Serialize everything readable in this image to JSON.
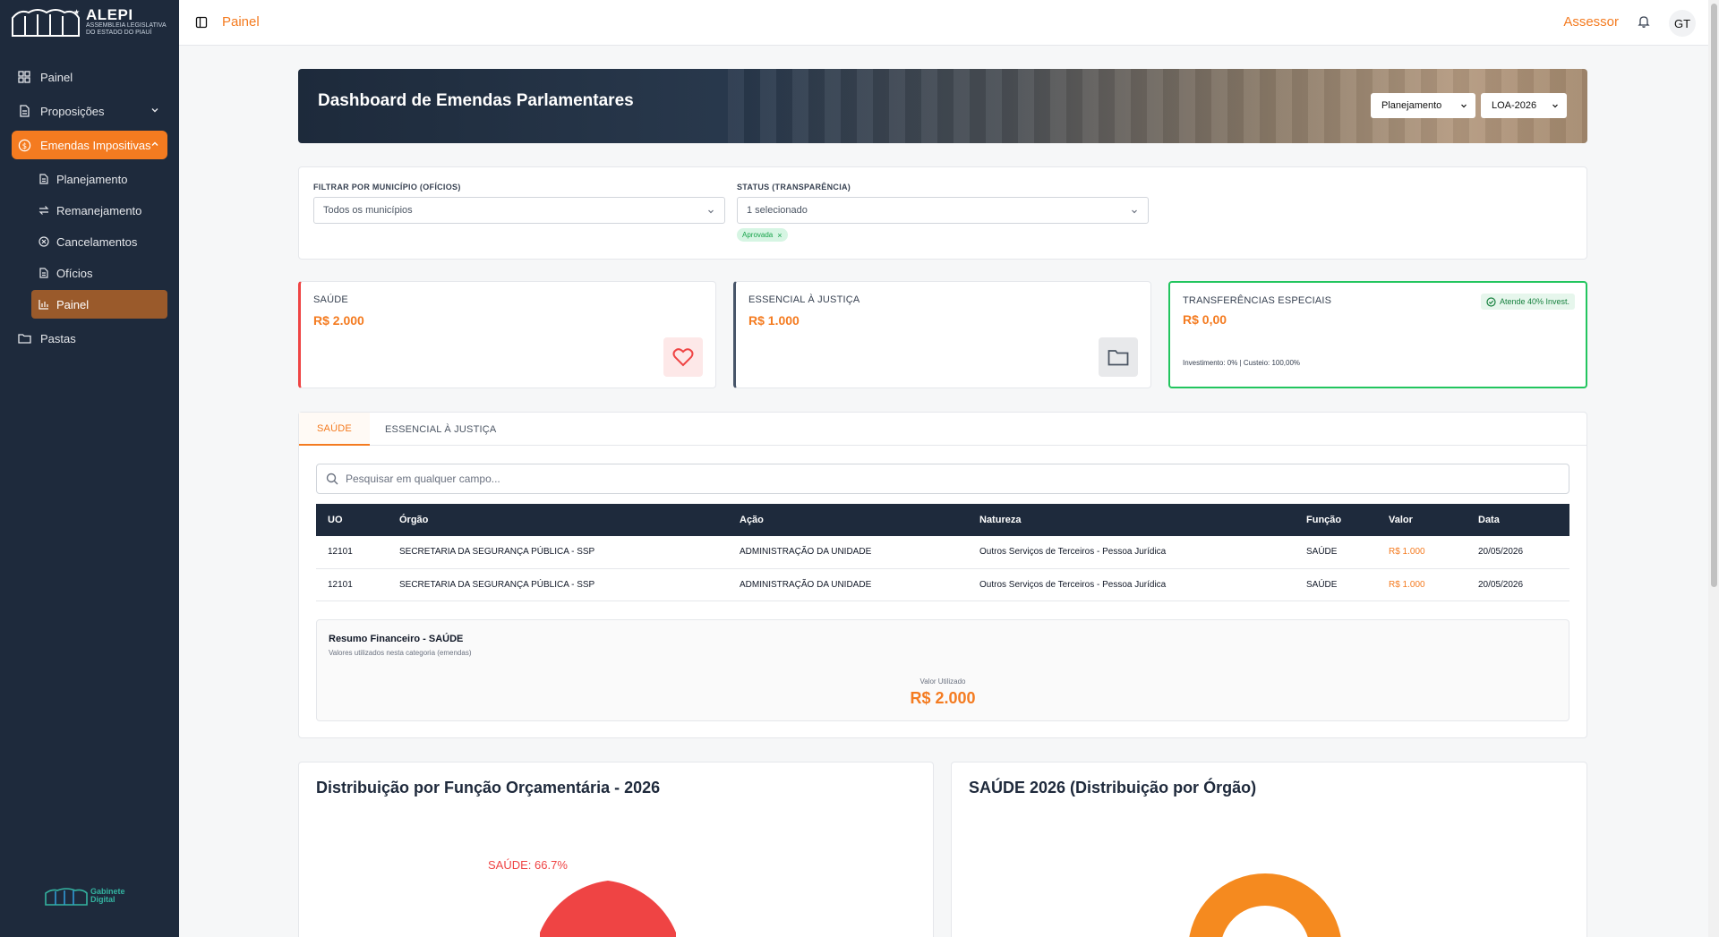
{
  "sidebar": {
    "logo": {
      "name": "ALEPI",
      "subtitle_line1": "ASSEMBLEIA LEGISLATIVA",
      "subtitle_line2": "DO ESTADO DO PIAUÍ"
    },
    "items": [
      {
        "label": "Painel",
        "icon": "grid-icon"
      },
      {
        "label": "Proposições",
        "icon": "document-icon"
      },
      {
        "label": "Emendas Impositivas",
        "icon": "dollar-circle-icon",
        "active": true
      },
      {
        "label": "Pastas",
        "icon": "folder-icon"
      }
    ],
    "subitems": [
      {
        "label": "Planejamento",
        "icon": "file-icon"
      },
      {
        "label": "Remanejamento",
        "icon": "swap-icon"
      },
      {
        "label": "Cancelamentos",
        "icon": "x-circle-icon"
      },
      {
        "label": "Ofícios",
        "icon": "file-icon"
      },
      {
        "label": "Painel",
        "icon": "bar-chart-icon",
        "active": true
      }
    ],
    "footer": {
      "line1": "Gabinete",
      "line2": "Digital"
    }
  },
  "header": {
    "breadcrumb": "Painel",
    "role": "Assessor",
    "avatar": "GT"
  },
  "hero": {
    "title": "Dashboard de Emendas Parlamentares",
    "select1": "Planejamento",
    "select2": "LOA-2026"
  },
  "filters": {
    "municipio_label": "FILTRAR POR MUNICÍPIO (OFÍCIOS)",
    "municipio_value": "Todos os municípios",
    "status_label": "STATUS (TRANSPARÊNCIA)",
    "status_value": "1 selecionado",
    "status_tag": "Aprovada"
  },
  "stats": [
    {
      "title": "SAÚDE",
      "value": "R$ 2.000",
      "accent": "#ef4444"
    },
    {
      "title": "ESSENCIAL À JUSTIÇA",
      "value": "R$ 1.000",
      "accent": "#475569"
    },
    {
      "title": "TRANSFERÊNCIAS ESPECIAIS",
      "value": "R$ 0,00",
      "accent": "#22c55e",
      "badge": "Atende 40% Invest.",
      "note": "Investimento: 0% | Custeio: 100,00%"
    }
  ],
  "tabs": [
    "SAÚDE",
    "ESSENCIAL À JUSTIÇA"
  ],
  "search": {
    "placeholder": "Pesquisar em qualquer campo..."
  },
  "table": {
    "headers": [
      "UO",
      "Órgão",
      "Ação",
      "Natureza",
      "Função",
      "Valor",
      "Data"
    ],
    "rows": [
      [
        "12101",
        "SECRETARIA DA SEGURANÇA PÚBLICA - SSP",
        "ADMINISTRAÇÃO DA UNIDADE",
        "Outros Serviços de Terceiros - Pessoa Jurídica",
        "SAÚDE",
        "R$ 1.000",
        "20/05/2026"
      ],
      [
        "12101",
        "SECRETARIA DA SEGURANÇA PÚBLICA - SSP",
        "ADMINISTRAÇÃO DA UNIDADE",
        "Outros Serviços de Terceiros - Pessoa Jurídica",
        "SAÚDE",
        "R$ 1.000",
        "20/05/2026"
      ]
    ]
  },
  "summary": {
    "title": "Resumo Financeiro - SAÚDE",
    "subtitle": "Valores utilizados nesta categoria (emendas)",
    "label": "Valor Utilizado",
    "value": "R$ 2.000"
  },
  "charts": {
    "left_title": "Distribuição por Função Orçamentária - 2026",
    "left_label": "SAÚDE: 66.7%",
    "right_title": "SAÚDE 2026 (Distribuição por Órgão)"
  },
  "colors": {
    "accent": "#f47b20",
    "sidebar": "#1e2a3c",
    "pie_red": "#ef4444",
    "donut_orange": "#f58a1f"
  }
}
